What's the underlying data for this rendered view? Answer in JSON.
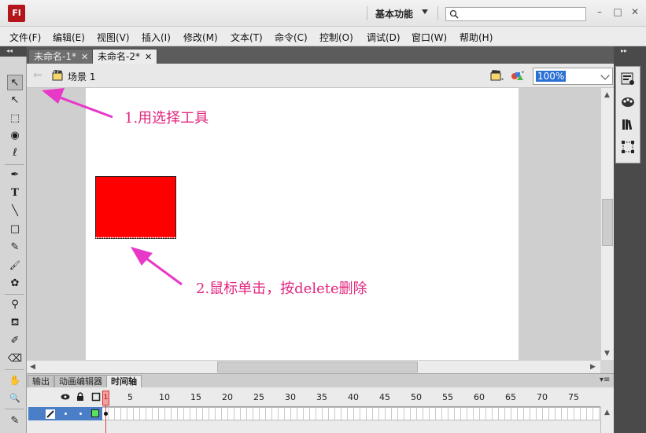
{
  "app": {
    "logo": "Fl",
    "workspace": "基本功能"
  },
  "menu": [
    "文件(F)",
    "编辑(E)",
    "视图(V)",
    "插入(I)",
    "修改(M)",
    "文本(T)",
    "命令(C)",
    "控制(O)",
    "调试(D)",
    "窗口(W)",
    "帮助(H)"
  ],
  "window_controls": {
    "minimize": "–",
    "restore": "□",
    "close": "✕"
  },
  "doc_tabs": [
    {
      "label": "未命名-1*",
      "active": false
    },
    {
      "label": "未命名-2*",
      "active": true
    }
  ],
  "tab_close": "✕",
  "editbar": {
    "back": "⇐",
    "scene": "场景 1",
    "zoom": "100%"
  },
  "tools": {
    "selection": "↖",
    "subselection": "↖",
    "free_transform": "⬚",
    "3d_rotation": "◉",
    "lasso": "ℓ",
    "pen": "✒",
    "text": "T",
    "line": "╲",
    "rectangle": "□",
    "pencil": "✎",
    "brush": "🖌",
    "deco": "✿",
    "bone": "⚲",
    "paint_bucket": "⛾",
    "eyedropper": "✐",
    "eraser": "⌫",
    "hand": "✋",
    "zoom": "🔍",
    "stroke": "✎"
  },
  "annotations": {
    "step1": "1.用选择工具",
    "step2": "2.鼠标单击，按delete删除"
  },
  "colors": {
    "accent": "#e0267e",
    "shape_fill": "#ff0000",
    "selection": "#2a6fd3"
  },
  "timeline": {
    "tabs": [
      {
        "label": "输出",
        "active": false
      },
      {
        "label": "动画编辑器",
        "active": false
      },
      {
        "label": "时间轴",
        "active": true
      }
    ],
    "menu": "▾≡",
    "frame_numbers": [
      "5",
      "10",
      "15",
      "20",
      "25",
      "30",
      "35",
      "40",
      "45",
      "50",
      "55",
      "60",
      "65",
      "70",
      "75"
    ],
    "current_frame": "1"
  }
}
